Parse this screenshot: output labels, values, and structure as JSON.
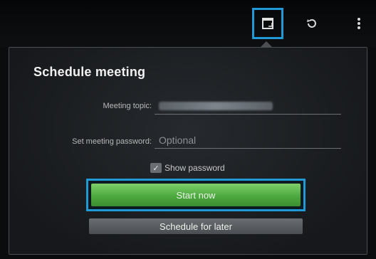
{
  "actionbar": {
    "icons": [
      "window-icon",
      "refresh-icon",
      "overflow-menu-icon"
    ]
  },
  "dialog": {
    "title": "Schedule meeting",
    "topic_label": "Meeting topic:",
    "topic_value": "",
    "password_label": "Set meeting password:",
    "password_placeholder": "Optional",
    "show_password_label": "Show password",
    "show_password_checked": true,
    "start_now_label": "Start now",
    "schedule_later_label": "Schedule for later"
  },
  "colors": {
    "highlight": "#1f9ad6",
    "start_button": "#4da93f",
    "secondary_button": "#5a5e63"
  }
}
